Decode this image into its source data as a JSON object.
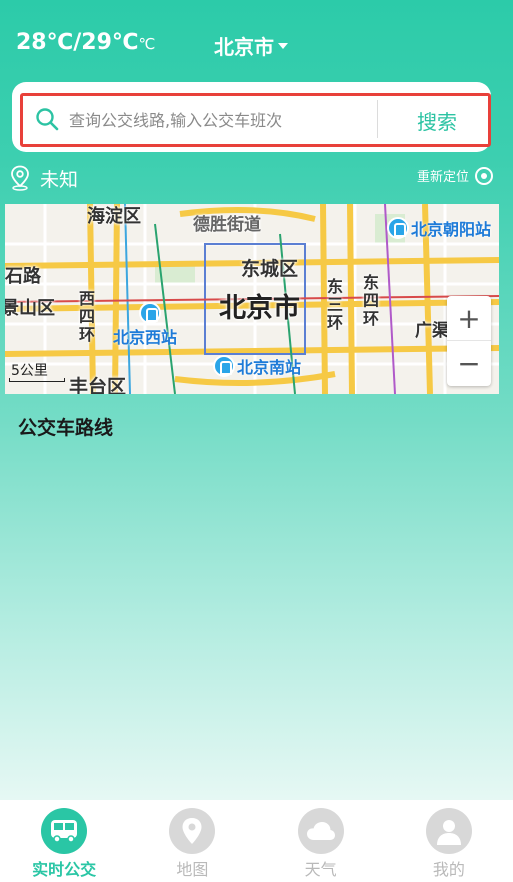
{
  "header": {
    "temperature": "28℃/29℃",
    "temperature_unit": "℃",
    "city": "北京市"
  },
  "search": {
    "placeholder": "查询公交线路,输入公交车班次",
    "value": "",
    "button_label": "搜索",
    "highlight_color": "#e8403a"
  },
  "location": {
    "current": "未知",
    "relocate_label": "重新定位"
  },
  "map": {
    "center_label": "北京市",
    "districts": [
      "海淀区",
      "德胜街道",
      "东城区",
      "石路",
      "景山区",
      "丰台区",
      "广渠"
    ],
    "ring_roads": [
      "西四环",
      "东三环",
      "东四环"
    ],
    "stations": [
      "北京朝阳站",
      "北京西站",
      "北京南站"
    ],
    "scale": "5公里",
    "zoom_in": "+",
    "zoom_out": "−"
  },
  "content": {
    "section_title": "公交车路线"
  },
  "tabbar": {
    "active_color": "#2ac6a5",
    "items": [
      {
        "label": "实时公交",
        "icon": "bus-icon",
        "active": true
      },
      {
        "label": "地图",
        "icon": "map-pin-icon",
        "active": false
      },
      {
        "label": "天气",
        "icon": "cloud-icon",
        "active": false
      },
      {
        "label": "我的",
        "icon": "user-icon",
        "active": false
      }
    ]
  }
}
